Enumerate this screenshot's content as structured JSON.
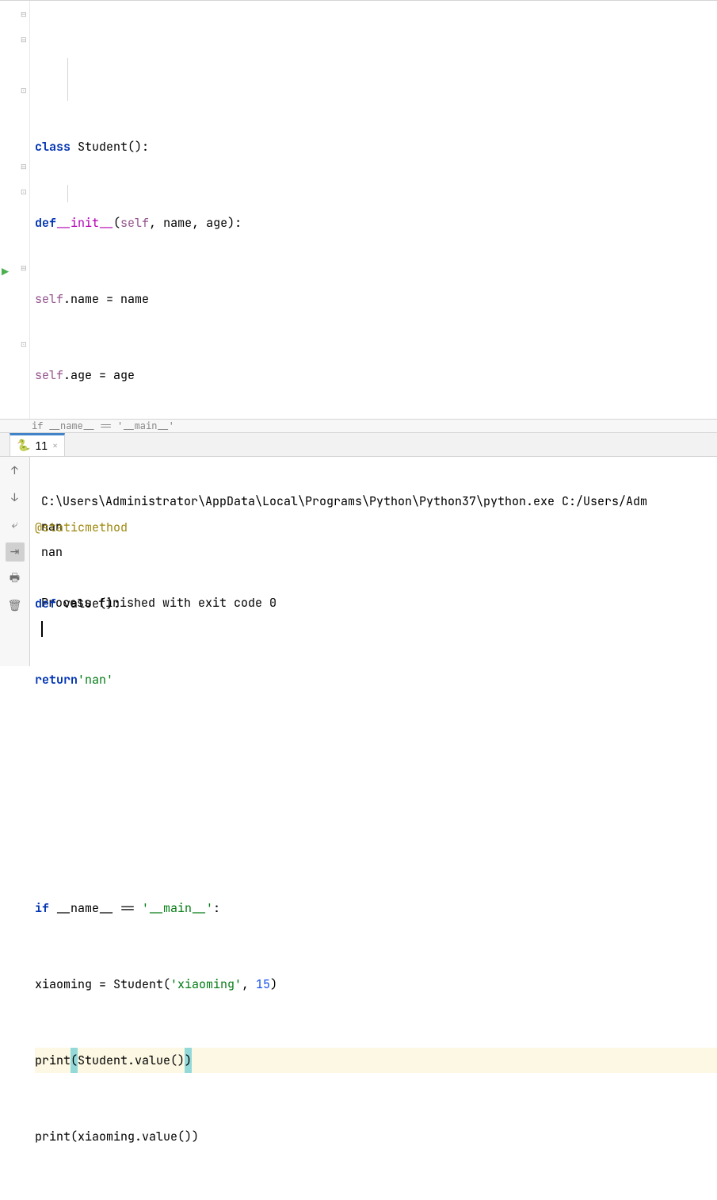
{
  "code": {
    "kw_class": "class",
    "class_name": " Student():",
    "kw_def": "def",
    "init_name": "__init__",
    "kw_self": "self",
    "init_params": ", name, age):",
    "init_open_paren": "(",
    "body1a": ".name = name",
    "body2a": ".age = age",
    "decorator": "@staticmethod",
    "value_fn": " value():",
    "kw_return": "return",
    "nan_str": "'nan'",
    "kw_if": "if",
    "main_cond1": " __name__ == ",
    "main_str": "'__main__'",
    "main_cond2": ":",
    "assign1a": "xiaoming = Student(",
    "xm_str": "'xiaoming'",
    "assign1b": ", ",
    "num15": "15",
    "assign1c": ")",
    "print_kw": "print",
    "print1_mid": "Student.value()",
    "print2_body": "(xiaoming.value())"
  },
  "breadcrumb": "if __name__ == '__main__'",
  "console": {
    "tab_name": "11",
    "cmd": "C:\\Users\\Administrator\\AppData\\Local\\Programs\\Python\\Python37\\python.exe C:/Users/Adm",
    "out1": "nan",
    "out2": "nan",
    "exit": "Process finished with exit code 0"
  }
}
